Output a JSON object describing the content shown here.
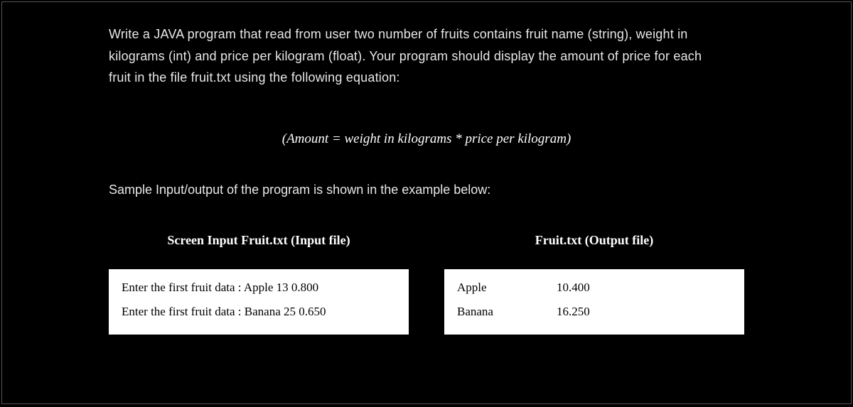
{
  "problem": {
    "line1": "Write a JAVA program that read from user two number of fruits contains fruit name (string), weight in",
    "line2": "kilograms (int) and price per kilogram (float). Your program should display the amount of price for each",
    "line3": "fruit in the file fruit.txt using the following equation:"
  },
  "equation": "(Amount = weight in kilograms * price per kilogram)",
  "sample_label": "Sample Input/output of the program is shown in the example below:",
  "input_header": "Screen Input Fruit.txt (Input file)",
  "output_header": "Fruit.txt (Output file)",
  "input_box": {
    "row1": "Enter the first fruit data : Apple 13 0.800",
    "row2": "Enter the first fruit data : Banana 25 0.650"
  },
  "output_box": {
    "row1_name": "Apple",
    "row1_value": "10.400",
    "row2_name": "Banana",
    "row2_value": "16.250"
  }
}
